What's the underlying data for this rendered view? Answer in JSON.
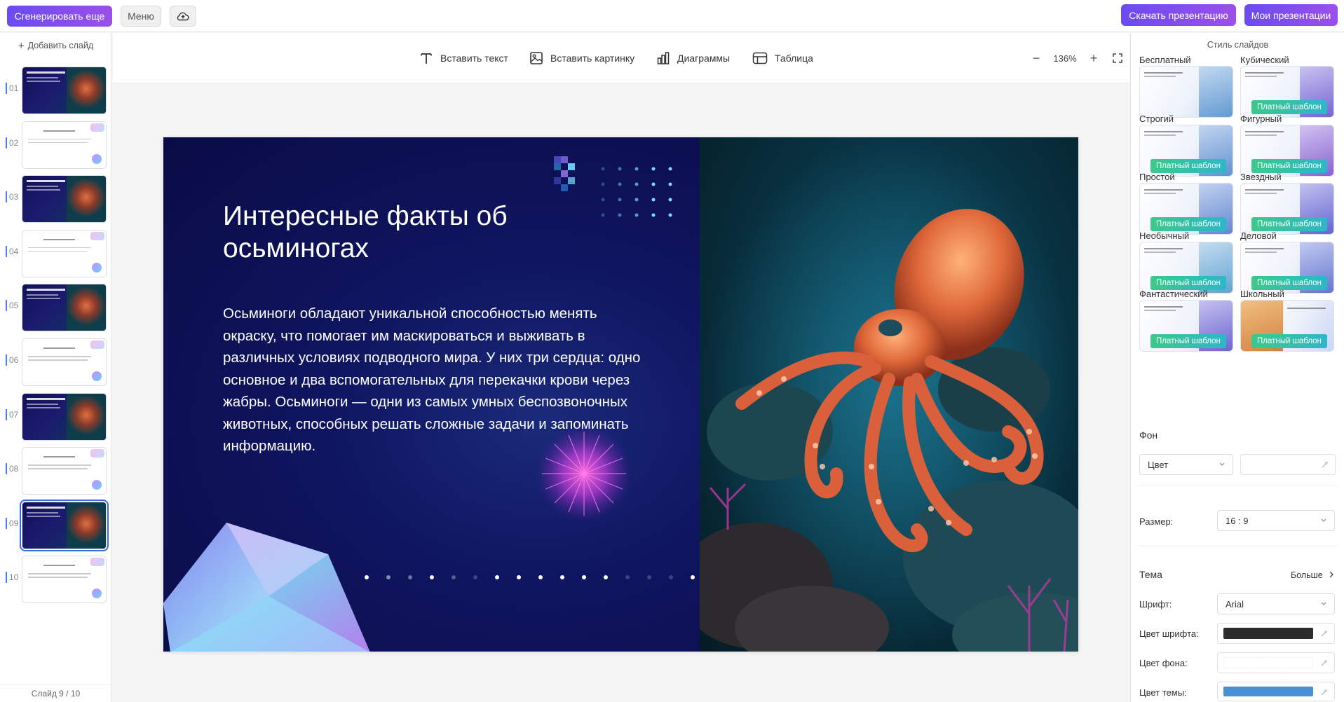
{
  "topbar": {
    "generate_more": "Сгенерировать еще",
    "menu": "Меню",
    "download": "Скачать презентацию",
    "my_presentations": "Мои презентации"
  },
  "sidebar": {
    "add_slide": "Добавить слайд",
    "counter": "Слайд 9 / 10",
    "slides": [
      {
        "num": "01",
        "theme": "dark"
      },
      {
        "num": "02",
        "theme": "light"
      },
      {
        "num": "03",
        "theme": "dark"
      },
      {
        "num": "04",
        "theme": "light"
      },
      {
        "num": "05",
        "theme": "dark"
      },
      {
        "num": "06",
        "theme": "light"
      },
      {
        "num": "07",
        "theme": "dark"
      },
      {
        "num": "08",
        "theme": "light"
      },
      {
        "num": "09",
        "theme": "dark",
        "active": true
      },
      {
        "num": "10",
        "theme": "light"
      }
    ]
  },
  "toolbar": {
    "insert_text": "Вставить текст",
    "insert_image": "Вставить картинку",
    "charts": "Диаграммы",
    "table": "Таблица",
    "zoom": "136%"
  },
  "slide": {
    "title": "Интересные факты об осьминогах",
    "body": "Осьминоги обладают уникальной способностью менять окраску, что помогает им маскироваться и выживать в различных условиях подводного мира. У них три сердца: одно основное и два вспомогательных для перекачки крови через жабры. Осьминоги — одни из самых умных беспозвоночных животных, способных решать сложные задачи и запоминать информацию."
  },
  "styles_panel": {
    "title": "Стиль слайдов",
    "paid_label": "Платный шаблон",
    "styles": [
      {
        "name": "Бесплатный",
        "paid": false
      },
      {
        "name": "Кубический",
        "paid": true
      },
      {
        "name": "Строгий",
        "paid": true
      },
      {
        "name": "Фигурный",
        "paid": true
      },
      {
        "name": "Простой",
        "paid": true
      },
      {
        "name": "Звездный",
        "paid": true
      },
      {
        "name": "Необычный",
        "paid": true
      },
      {
        "name": "Деловой",
        "paid": true
      },
      {
        "name": "Фантастический",
        "paid": true
      },
      {
        "name": "Школьный",
        "paid": true
      }
    ],
    "background_label": "Фон",
    "background_select": "Цвет",
    "size_label": "Размер:",
    "size_value": "16 : 9",
    "theme_label": "Тема",
    "more": "Больше",
    "font_label": "Шрифт:",
    "font_value": "Arial",
    "font_color_label": "Цвет шрифта:",
    "font_color": "#2b2b2b",
    "bg_color_label": "Цвет фона:",
    "bg_color": "#ffffff",
    "theme_color_label": "Цвет темы:",
    "theme_color": "#4a90d9"
  },
  "colors": {
    "accent_gradient_start": "#6a4cf0",
    "accent_gradient_end": "#9b4fe8",
    "slide_bg": "#0a0b45",
    "octopus": "#e06a3a"
  }
}
